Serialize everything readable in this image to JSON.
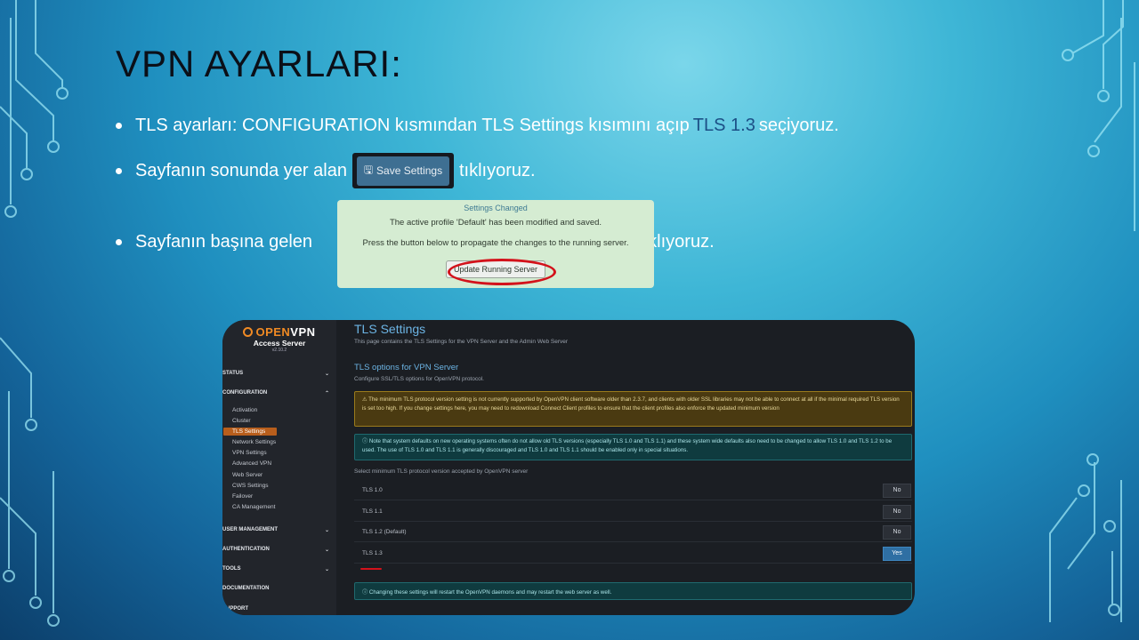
{
  "slide": {
    "title": "VPN AYARLARI:",
    "bullet1": {
      "prefix": "TLS ayarları: CONFIGURATION  kısmından TLS Settings kısımını açıp",
      "highlight": "TLS 1.3",
      "suffix": "seçiyoruz."
    },
    "bullet2": {
      "prefix": "Sayfanın sonunda yer alan",
      "button_label": "Save Settings",
      "suffix": "tıklıyoruz."
    },
    "bullet3": {
      "prefix": "Sayfanın başına gelen",
      "suffix": "tıklıyoruz."
    }
  },
  "notice": {
    "title": "Settings Changed",
    "line1": "The active profile 'Default' has been modified and saved.",
    "line2": "Press the button below to propagate the changes to the running server.",
    "button": "Update Running Server"
  },
  "openvpn": {
    "logo": {
      "brand_open": "OPEN",
      "brand_vpn": "VPN",
      "product": "Access Server",
      "version": "v2.10.2"
    },
    "sidebar": {
      "status": "STATUS",
      "configuration": "CONFIGURATION",
      "config_items": [
        "Activation",
        "Cluster",
        "TLS Settings",
        "Network Settings",
        "VPN Settings",
        "Advanced VPN",
        "Web Server",
        "CWS Settings",
        "Failover",
        "CA Management"
      ],
      "user_management": "USER  MANAGEMENT",
      "authentication": "AUTHENTICATION",
      "tools": "TOOLS",
      "documentation": "DOCUMENTATION",
      "support": "SUPPORT"
    },
    "main": {
      "title": "TLS Settings",
      "description": "This page contains the TLS Settings for the VPN Server and the Admin Web Server",
      "section_title": "TLS options for VPN Server",
      "section_desc": "Configure SSL/TLS options for OpenVPN protocol.",
      "warning": "⚠ The minimum TLS protocol version setting is not currently supported by OpenVPN client software older than 2.3.7, and clients with older SSL libraries may not be able to connect at all if the minimal required TLS version is set too high. If you change settings here, you may need to redownload Connect Client profiles to ensure that the client profiles also enforce the updated minimum version",
      "info": "ⓘ Note that system defaults on new operating systems often do not allow old TLS versions (especially TLS 1.0 and TLS 1.1) and these system wide defaults also need to be changed to allow TLS 1.0 and TLS 1.2 to be used. The use of TLS 1.0 and TLS 1.1 is generally discouraged and TLS 1.0 and TLS 1.1 should be enabled only in special situations.",
      "select_label": "Select minimum TLS protocol version accepted by OpenVPN server",
      "rows": [
        {
          "label": "TLS 1.0",
          "value": "No"
        },
        {
          "label": "TLS 1.1",
          "value": "No"
        },
        {
          "label": "TLS 1.2 (Default)",
          "value": "No"
        },
        {
          "label": "TLS 1.3",
          "value": "Yes"
        }
      ],
      "footer_info": "ⓘ Changing these settings will restart the OpenVPN daemons and may restart the web server as well."
    }
  },
  "colors": {
    "accent_orange": "#f08a24",
    "toggle_yes": "#2f6fa3",
    "annotation_red": "#d3121b"
  }
}
